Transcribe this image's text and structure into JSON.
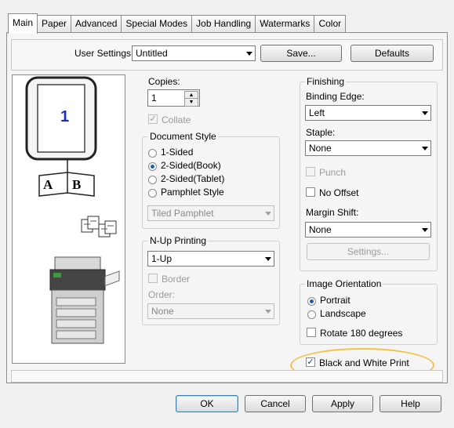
{
  "tabs": [
    "Main",
    "Paper",
    "Advanced",
    "Special Modes",
    "Job Handling",
    "Watermarks",
    "Color"
  ],
  "user_settings": {
    "label": "User Settings:",
    "value": "Untitled",
    "save_label": "Save...",
    "defaults_label": "Defaults"
  },
  "preview": {
    "page_number": "1",
    "book_left": "A",
    "book_right": "B"
  },
  "copies": {
    "label": "Copies:",
    "value": "1"
  },
  "collate": {
    "label": "Collate",
    "checked": true,
    "disabled": true
  },
  "document_style": {
    "label": "Document Style",
    "options": [
      "1-Sided",
      "2-Sided(Book)",
      "2-Sided(Tablet)",
      "Pamphlet Style"
    ],
    "selected": "2-Sided(Book)",
    "pamphlet_value": "Tiled Pamphlet"
  },
  "nup": {
    "label": "N-Up Printing",
    "value": "1-Up",
    "border_label": "Border",
    "order_label": "Order:",
    "order_value": "None"
  },
  "finishing": {
    "label": "Finishing",
    "binding_edge_label": "Binding Edge:",
    "binding_edge_value": "Left",
    "staple_label": "Staple:",
    "staple_value": "None",
    "punch_label": "Punch",
    "no_offset_label": "No Offset",
    "margin_shift_label": "Margin Shift:",
    "margin_shift_value": "None",
    "settings_label": "Settings..."
  },
  "image_orientation": {
    "label": "Image Orientation",
    "portrait_label": "Portrait",
    "landscape_label": "Landscape",
    "selected": "Portrait",
    "rotate_label": "Rotate 180 degrees"
  },
  "bw_print": {
    "label": "Black and White Print",
    "checked": true
  },
  "dialog_buttons": {
    "ok": "OK",
    "cancel": "Cancel",
    "apply": "Apply",
    "help": "Help"
  },
  "colors": {
    "accent": "#1b5fad",
    "highlight": "#f2c24b",
    "page_number": "#1a2fbf"
  }
}
